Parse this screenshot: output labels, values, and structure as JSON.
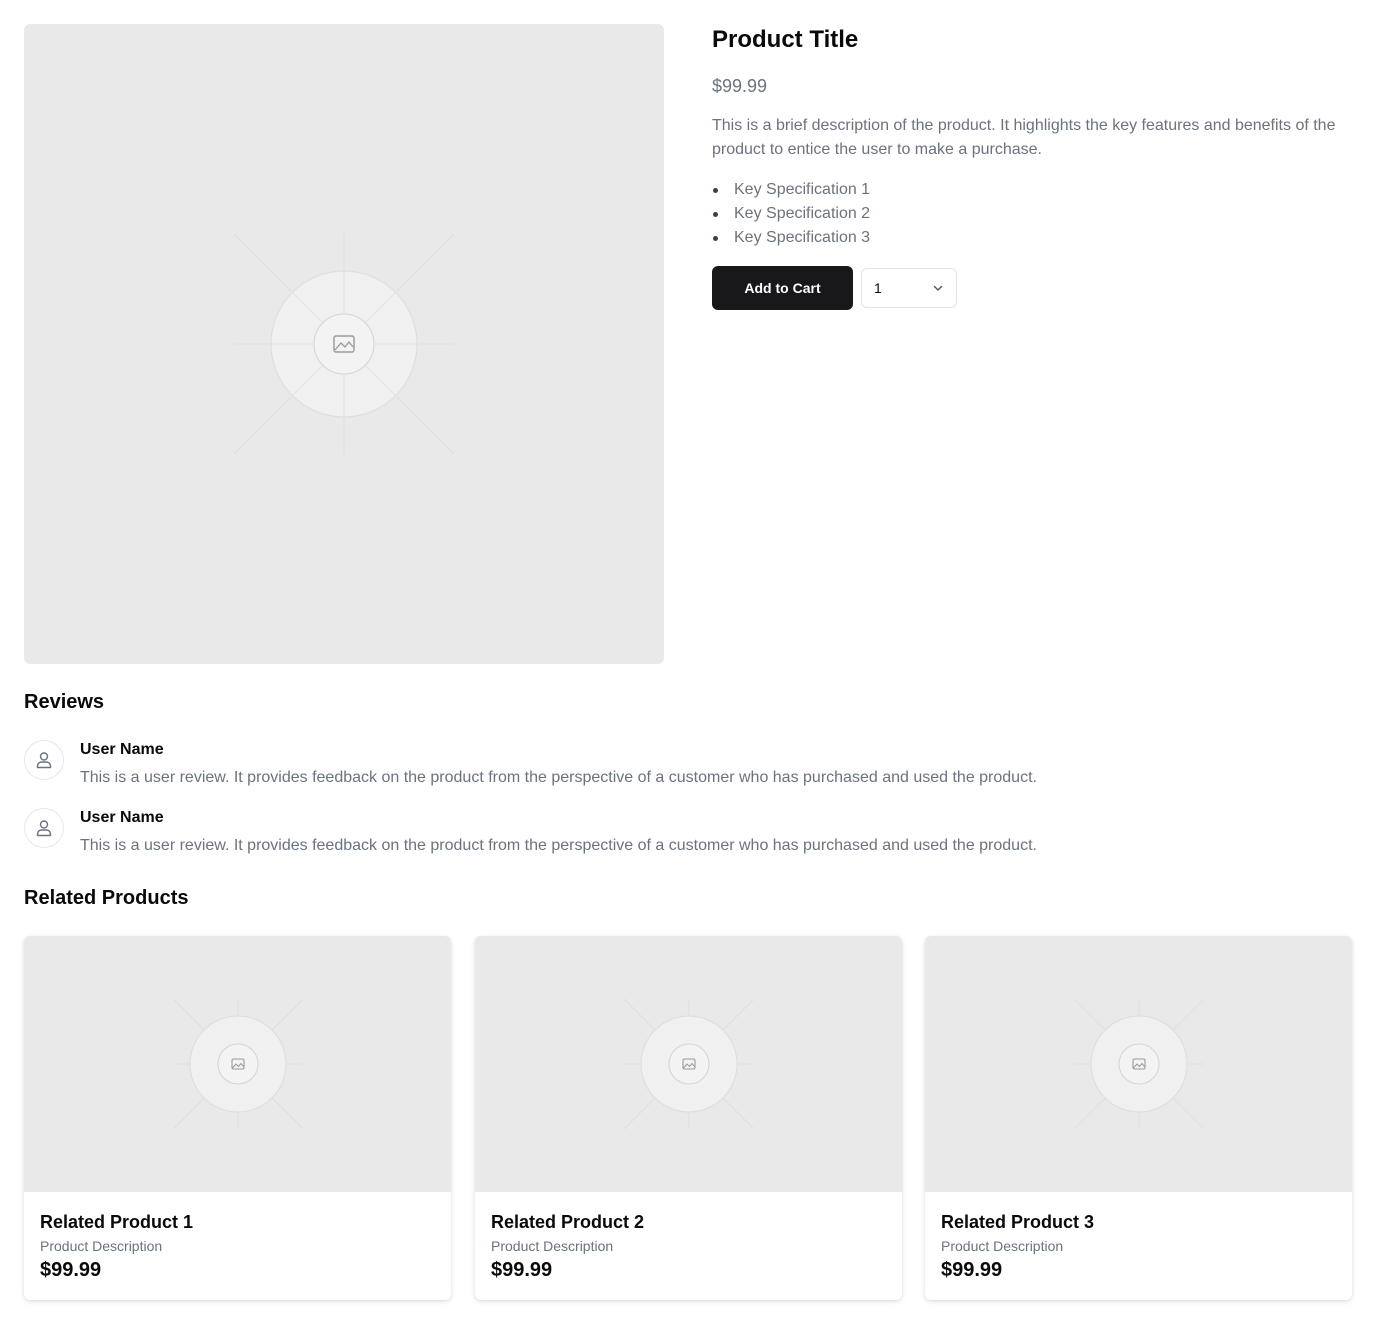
{
  "product": {
    "title": "Product Title",
    "price": "$99.99",
    "description": "This is a brief description of the product. It highlights the key features and benefits of the product to entice the user to make a purchase.",
    "specs": [
      "Key Specification 1",
      "Key Specification 2",
      "Key Specification 3"
    ],
    "add_to_cart_label": "Add to Cart",
    "quantity_value": "1"
  },
  "reviews": {
    "title": "Reviews",
    "items": [
      {
        "user": "User Name",
        "text": "This is a user review. It provides feedback on the product from the perspective of a customer who has purchased and used the product."
      },
      {
        "user": "User Name",
        "text": "This is a user review. It provides feedback on the product from the perspective of a customer who has purchased and used the product."
      }
    ]
  },
  "related": {
    "title": "Related Products",
    "items": [
      {
        "name": "Related Product 1",
        "description": "Product Description",
        "price": "$99.99"
      },
      {
        "name": "Related Product 2",
        "description": "Product Description",
        "price": "$99.99"
      },
      {
        "name": "Related Product 3",
        "description": "Product Description",
        "price": "$99.99"
      }
    ]
  },
  "icons": {
    "image_placeholder": "image-icon",
    "avatar": "user-icon",
    "quantity": "chevron-down-icon"
  },
  "colors": {
    "button_bg": "#18181b",
    "placeholder_bg": "#e9e9e9",
    "muted_text": "#6b7280"
  }
}
